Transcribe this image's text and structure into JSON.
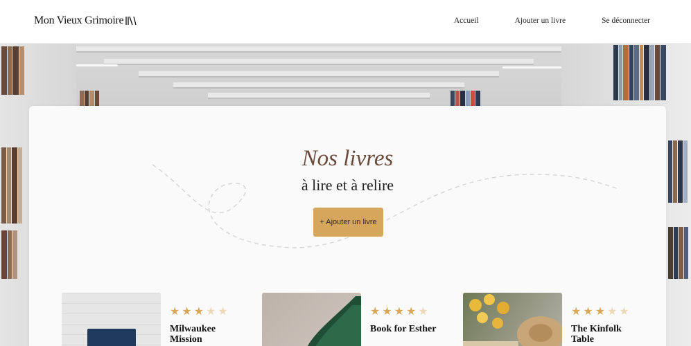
{
  "header": {
    "logo_text": "Mon Vieux Grimoire",
    "nav": [
      "Accueil",
      "Ajouter un livre",
      "Se déconnecter"
    ]
  },
  "hero": {
    "title": "Nos livres",
    "subtitle": "à lire et à relire",
    "add_button": "+ Ajouter un livre"
  },
  "books": [
    {
      "title": "Milwaukee Mission",
      "rating": 3,
      "max": 5
    },
    {
      "title": "Book for Esther",
      "rating": 4,
      "max": 5
    },
    {
      "title": "The Kinfolk Table",
      "rating": 3,
      "max": 5
    }
  ],
  "colors": {
    "accent": "#d6a65d",
    "title": "#6b4a3a",
    "star_on": "#d8a858",
    "star_off": "#ecd9ba"
  }
}
